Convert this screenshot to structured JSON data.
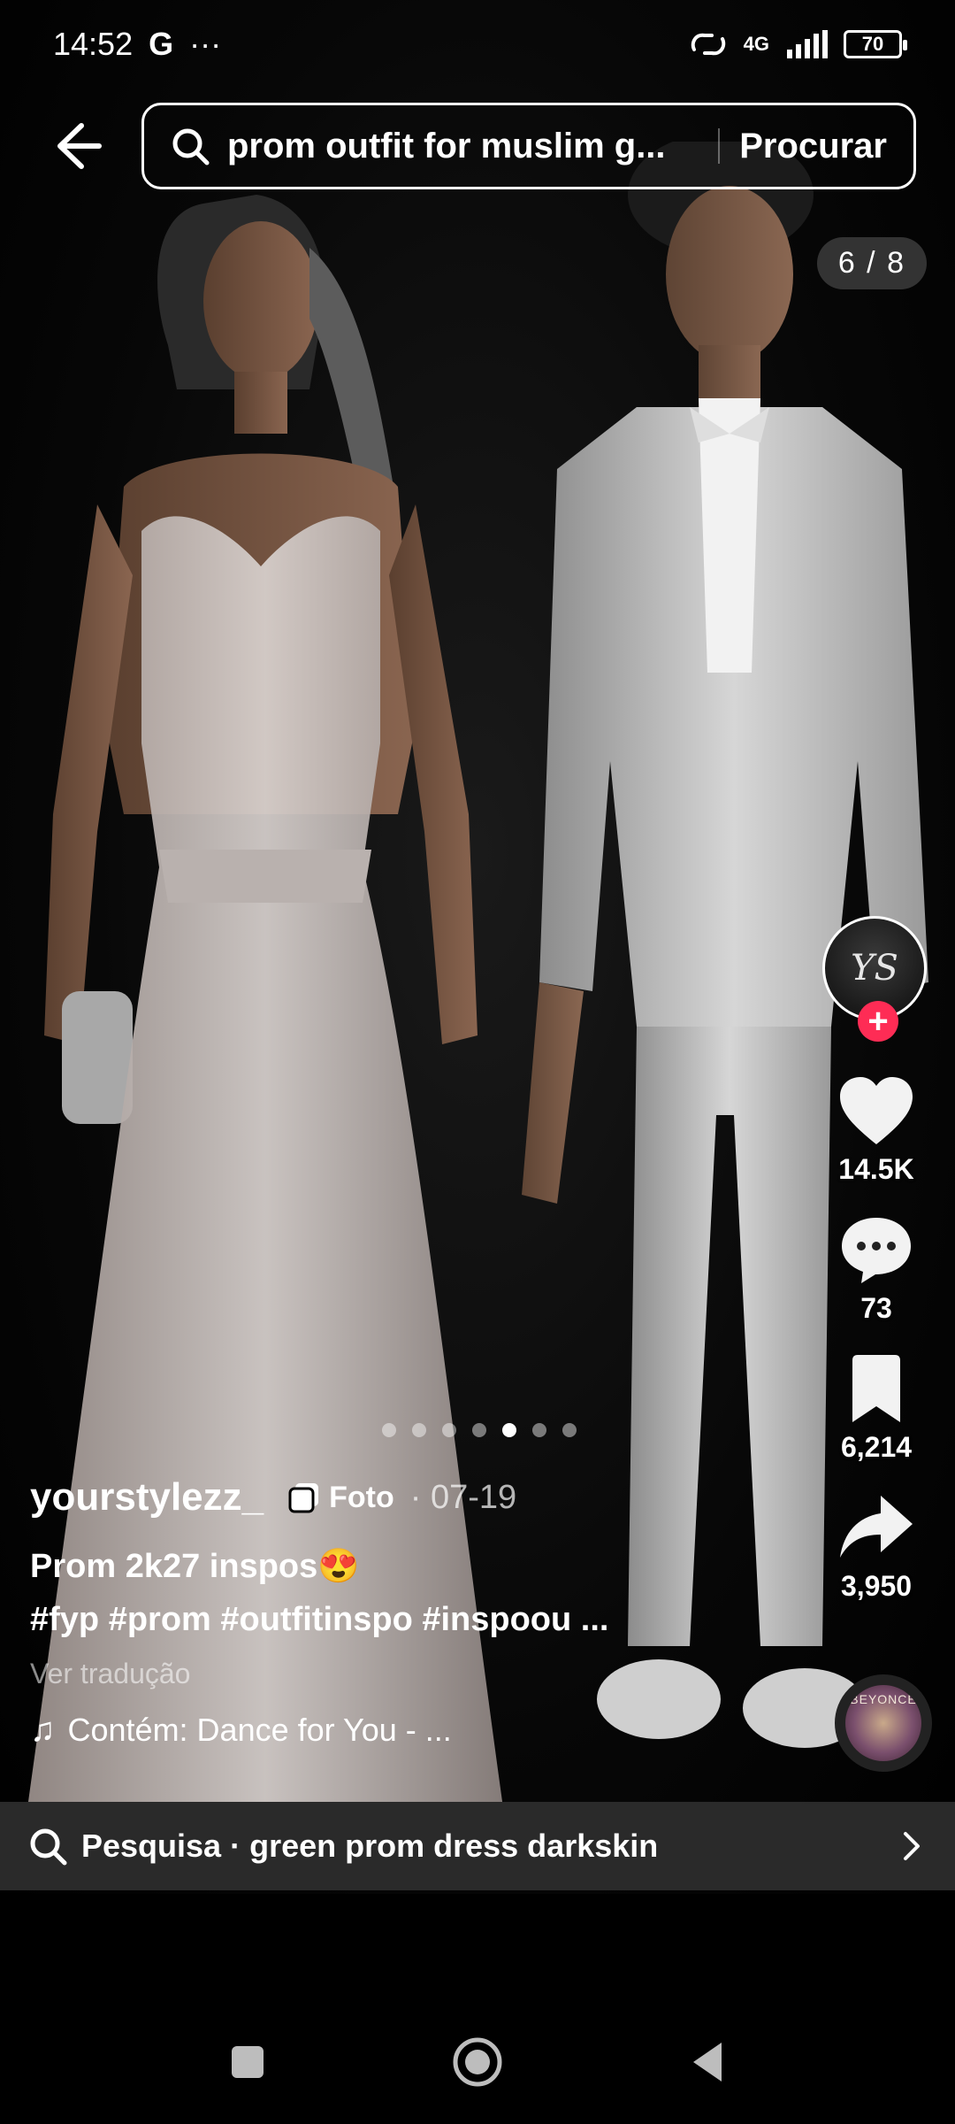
{
  "status_bar": {
    "time": "14:52",
    "google_letter": "G",
    "more": "···",
    "network": "4G",
    "battery": "70"
  },
  "search": {
    "query": "prom outfit for muslim g...",
    "submit_label": "Procurar"
  },
  "page_counter": "6 / 8",
  "carousel": {
    "count": 7,
    "active_index": 4
  },
  "post": {
    "username": "yourstylezz_",
    "type_badge": "Foto",
    "date": "· 07-19",
    "description": "Prom 2k27 inspos😍",
    "hashtags": "#fyp #prom #outfitinspo #inspoou ...",
    "translate": "Ver tradução",
    "music": "Contém: Dance for You - ..."
  },
  "actions": {
    "avatar_text": "YS",
    "likes": "14.5K",
    "comments": "73",
    "saves": "6,214",
    "shares": "3,950"
  },
  "music_disc": {
    "label": "BEYONCÉ"
  },
  "suggestion": {
    "text": "Pesquisa · green prom dress darkskin"
  },
  "colors": {
    "accent": "#fe2c55",
    "background": "#000000",
    "suggest_bar": "#2a2a2a"
  }
}
